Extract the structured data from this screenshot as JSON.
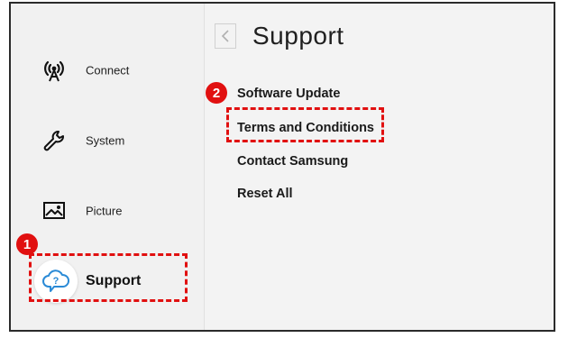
{
  "sidebar": {
    "items": [
      {
        "label": "Connect",
        "icon": "antenna-icon"
      },
      {
        "label": "System",
        "icon": "wrench-icon"
      },
      {
        "label": "Picture",
        "icon": "picture-icon"
      },
      {
        "label": "Support",
        "icon": "support-cloud-icon",
        "active": true
      }
    ]
  },
  "content": {
    "title": "Support",
    "menu": [
      "Software Update",
      "Terms and Conditions",
      "Contact Samsung",
      "Reset All"
    ]
  },
  "annotations": {
    "step1": "1",
    "step2": "2",
    "highlight_color": "#e11010"
  }
}
